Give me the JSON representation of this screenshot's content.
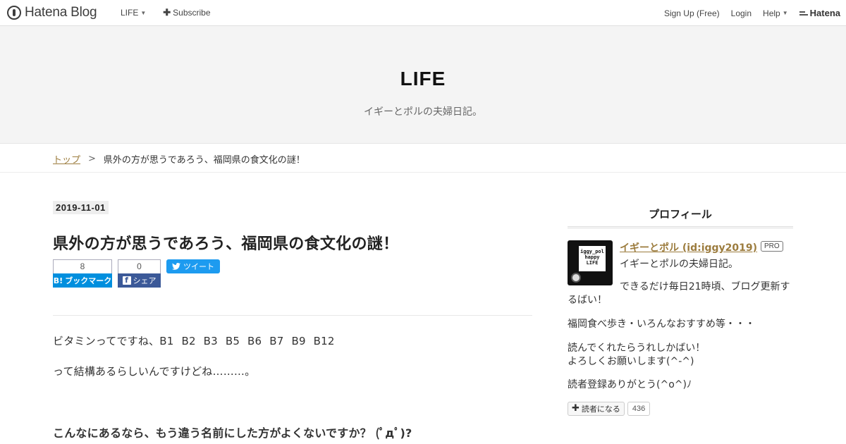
{
  "topbar": {
    "logo": "Hatena Blog",
    "nav_left": {
      "life": "LIFE",
      "subscribe": "Subscribe"
    },
    "nav_right": {
      "signup": "Sign Up (Free)",
      "login": "Login",
      "help": "Help",
      "brand": "Hatena"
    }
  },
  "header": {
    "title": "LIFE",
    "description": "イギーとポルの夫婦日記。"
  },
  "breadcrumb": {
    "top": "トップ",
    "separator": ">",
    "current": "県外の方が思うであろう、福岡県の食文化の謎！"
  },
  "entry": {
    "date": "2019-11-01",
    "title": "県外の方が思うであろう、福岡県の食文化の謎！",
    "share": {
      "hatena_count": "8",
      "hatena_label": "ブックマーク",
      "facebook_count": "0",
      "facebook_label": "シェア",
      "tweet_label": "ツイート"
    },
    "paragraphs": [
      "ビタミンってですね、B1 B2 B3 B5 B6 B7 B9 B12",
      "って結構あるらしいんですけどね………。",
      "こんなにあるなら、もう違う名前にした方がよくないですか？ (ﾟдﾟ)?"
    ]
  },
  "sidebar": {
    "title": "プロフィール",
    "avatar_text": "iggy_pol happy LIFE",
    "profile_name": "イギーとポル (id:iggy2019)",
    "pro_badge": "PRO",
    "lines": [
      "イギーとポルの夫婦日記。",
      "できるだけ毎日21時頃、ブログ更新するばい！",
      "福岡食べ歩き・いろんなおすすめ等・・・",
      "読んでくれたらうれしかばい！\nよろしくお願いします(^-^)",
      "読者登録ありがとう(^o^)ﾉ"
    ],
    "reader_button": "読者になる",
    "reader_count": "436"
  },
  "colors": {
    "link": "#9c7c3e",
    "hatena_blue": "#008fde",
    "facebook": "#3b5998",
    "twitter": "#1d9bf0",
    "header_bg": "#f4f4f4"
  }
}
